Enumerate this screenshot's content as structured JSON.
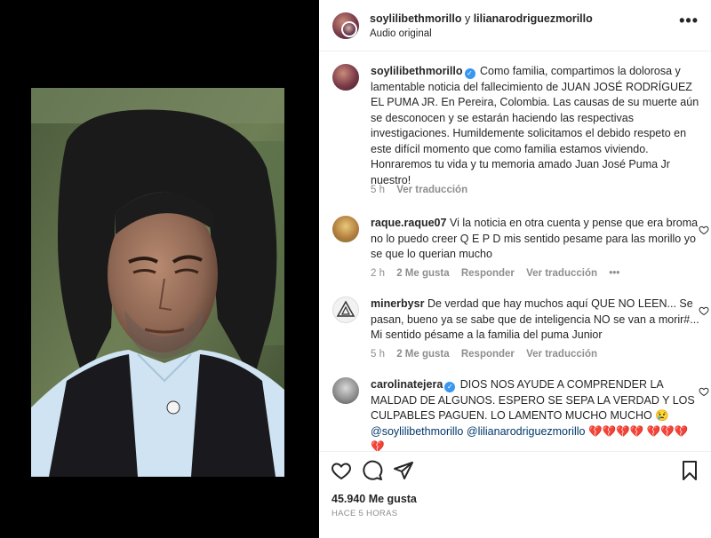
{
  "header": {
    "user1": "soylilibethmorillo",
    "and": " y ",
    "user2": "lilianarodriguezmorillo",
    "audio": "Audio original",
    "more": "•••"
  },
  "caption": {
    "user": "soylilibethmorillo",
    "text": "Como familia, compartimos la dolorosa y lamentable noticia del fallecimiento de JUAN JOSÉ RODRÍGUEZ EL PUMA JR. En Pereira, Colombia. Las causas de su muerte aún se desconocen y se estarán haciendo las respectivas investigaciones. Humildemente solicitamos el debido respeto en este difícil momento que como familia estamos viviendo. Honraremos tu vida y tu memoria amado Juan José Puma Jr nuestro!",
    "time": "5 h",
    "translate": "Ver traducción"
  },
  "comments": [
    {
      "user": "raque.raque07",
      "text": "Vi la noticia en otra cuenta y pense que era broma no lo puedo creer Q E P D mis sentido pesame para las morillo yo se que lo querian mucho",
      "time": "2 h",
      "likes": "2 Me gusta",
      "reply": "Responder",
      "translate": "Ver traducción",
      "more": "•••"
    },
    {
      "user": "minerbysr",
      "text": "De verdad que hay muchos aquí QUE NO LEEN... Se pasan, bueno ya se sabe que de inteligencia NO se van a morir#... Mi sentido pésame a la familia del puma Junior",
      "time": "5 h",
      "likes": "2 Me gusta",
      "reply": "Responder",
      "translate": "Ver traducción"
    },
    {
      "user": "carolinatejera",
      "text": "DIOS NOS AYUDE A COMPRENDER LA MALDAD DE ALGUNOS. ESPERO SE SEPA LA VERDAD Y LOS CULPABLES PAGUEN. LO LAMENTO MUCHO MUCHO",
      "emoji1": "😢",
      "mention1": "@soylilibethmorillo",
      "mention2": "@lilianarodriguezmorillo",
      "hearts1": "💔💔💔💔",
      "hearts2": "💔💔💔💔"
    }
  ],
  "footer": {
    "likes": "45.940 Me gusta",
    "time": "HACE 5 HORAS"
  },
  "colors": {
    "text": "#262626",
    "secondary": "#8e8e8e",
    "verified": "#3897f0",
    "mention": "#00376b"
  }
}
